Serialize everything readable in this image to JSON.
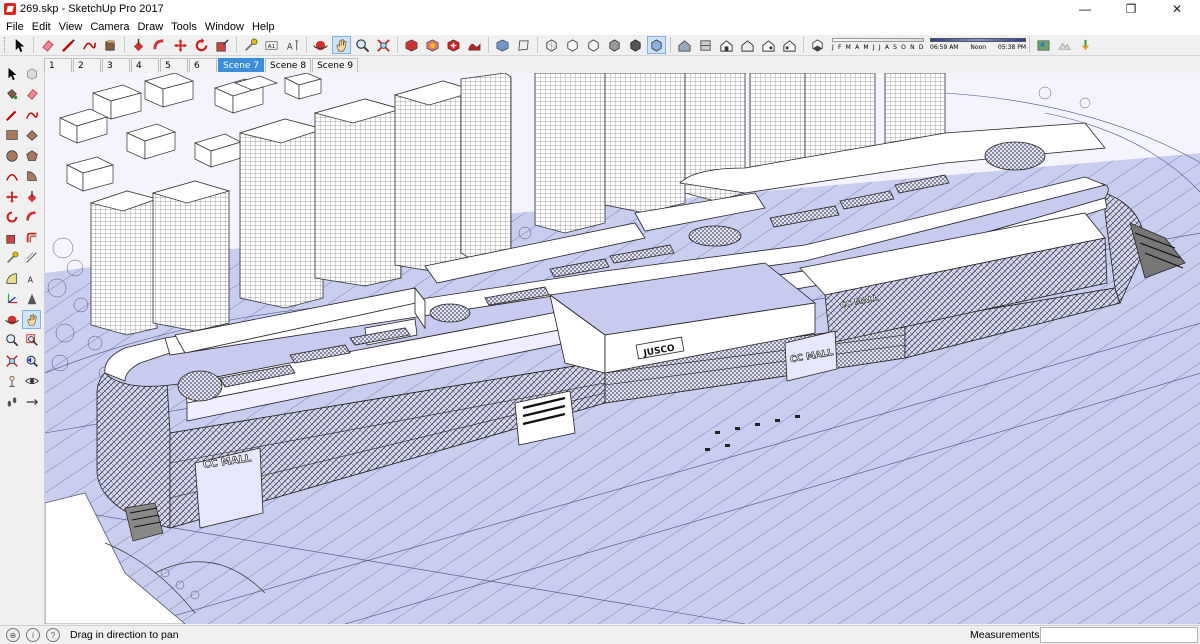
{
  "window": {
    "title": "269.skp - SketchUp Pro 2017",
    "minimize": "—",
    "maximize": "❐",
    "close": "✕"
  },
  "menu": [
    "File",
    "Edit",
    "View",
    "Camera",
    "Draw",
    "Tools",
    "Window",
    "Help"
  ],
  "shadows": {
    "months": [
      "J",
      "F",
      "M",
      "A",
      "M",
      "J",
      "J",
      "A",
      "S",
      "O",
      "N",
      "D"
    ],
    "time_start": "06:59 AM",
    "time_mid": "Noon",
    "time_end": "05:38 PM"
  },
  "scenes": {
    "tabs": [
      "1",
      "2",
      "3",
      "4",
      "5",
      "6",
      "Scene 7",
      "Scene 8",
      "Scene 9"
    ],
    "active": "Scene 7"
  },
  "viewport": {
    "signage": [
      "JUSCO",
      "CC MALL",
      "CC MALL",
      "CC MALL"
    ]
  },
  "status": {
    "hint": "Drag in direction to pan",
    "measurements_label": "Measurements",
    "measurements_value": ""
  },
  "colors": {
    "accent": "#3b8fd8",
    "model_face": "#d4d6f3",
    "model_roof": "#c8cbef",
    "active_tab": "#3b8fd8"
  }
}
